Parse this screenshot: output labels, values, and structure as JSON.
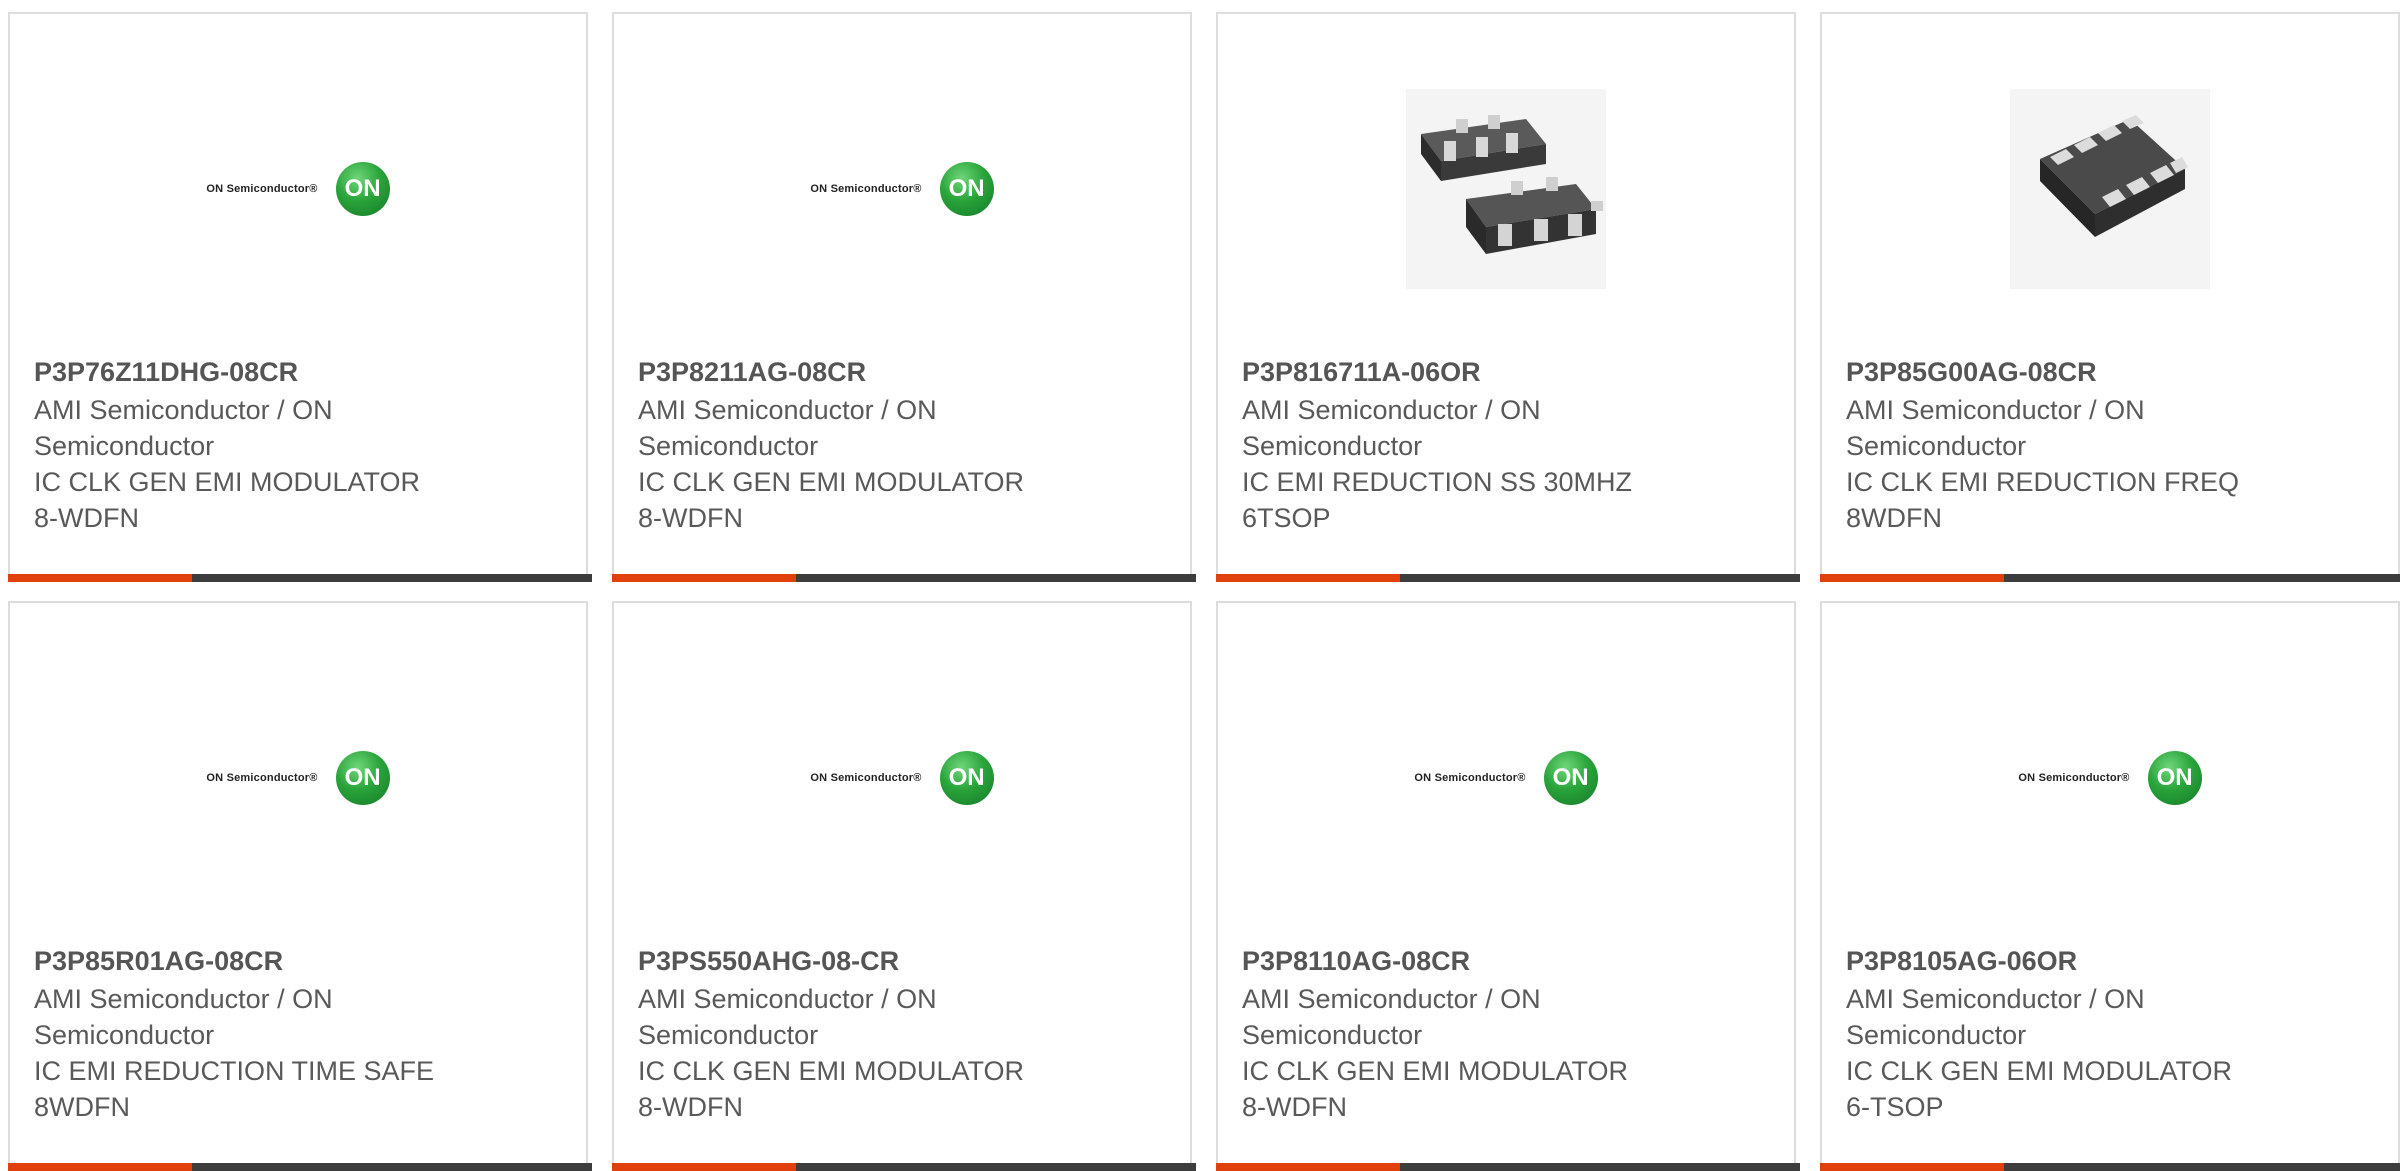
{
  "brand_logo_text": {
    "wordmark": "ON Semiconductor®",
    "badge": "ON"
  },
  "colors": {
    "accent_bar": "#e0400b",
    "dark_bar": "#3d3d3d",
    "logo_green": "#2aa43b"
  },
  "products": [
    {
      "part_number": "P3P76Z11DHG-08CR",
      "manufacturer_line1": "AMI Semiconductor / ON",
      "manufacturer_line2": "Semiconductor",
      "description_line1": "IC CLK GEN EMI MODULATOR",
      "description_line2": "8-WDFN",
      "image": "on-semiconductor-logo"
    },
    {
      "part_number": "P3P8211AG-08CR",
      "manufacturer_line1": "AMI Semiconductor / ON",
      "manufacturer_line2": "Semiconductor",
      "description_line1": "IC CLK GEN EMI MODULATOR",
      "description_line2": "8-WDFN",
      "image": "on-semiconductor-logo"
    },
    {
      "part_number": "P3P816711A-06OR",
      "manufacturer_line1": "AMI Semiconductor / ON",
      "manufacturer_line2": "Semiconductor",
      "description_line1": "IC EMI REDUCTION SS 30MHZ",
      "description_line2": "6TSOP",
      "image": "tsop-package-photo"
    },
    {
      "part_number": "P3P85G00AG-08CR",
      "manufacturer_line1": "AMI Semiconductor / ON",
      "manufacturer_line2": "Semiconductor",
      "description_line1": "IC CLK EMI REDUCTION FREQ",
      "description_line2": "8WDFN",
      "image": "wdfn-package-photo"
    },
    {
      "part_number": "P3P85R01AG-08CR",
      "manufacturer_line1": "AMI Semiconductor / ON",
      "manufacturer_line2": "Semiconductor",
      "description_line1": "IC EMI REDUCTION TIME SAFE",
      "description_line2": "8WDFN",
      "image": "on-semiconductor-logo"
    },
    {
      "part_number": "P3PS550AHG-08-CR",
      "manufacturer_line1": "AMI Semiconductor / ON",
      "manufacturer_line2": "Semiconductor",
      "description_line1": "IC CLK GEN EMI MODULATOR",
      "description_line2": "8-WDFN",
      "image": "on-semiconductor-logo"
    },
    {
      "part_number": "P3P8110AG-08CR",
      "manufacturer_line1": "AMI Semiconductor / ON",
      "manufacturer_line2": "Semiconductor",
      "description_line1": "IC CLK GEN EMI MODULATOR",
      "description_line2": "8-WDFN",
      "image": "on-semiconductor-logo"
    },
    {
      "part_number": "P3P8105AG-06OR",
      "manufacturer_line1": "AMI Semiconductor / ON",
      "manufacturer_line2": "Semiconductor",
      "description_line1": "IC CLK GEN EMI MODULATOR",
      "description_line2": "6-TSOP",
      "image": "on-semiconductor-logo"
    }
  ]
}
